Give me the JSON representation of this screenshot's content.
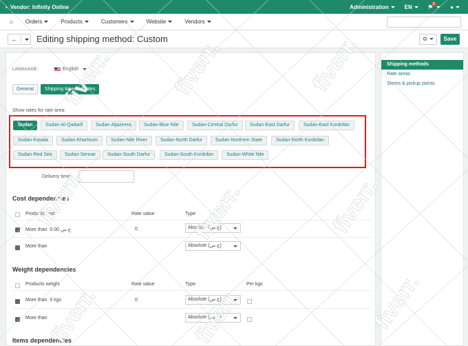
{
  "topbar": {
    "vendor": "Vendor: Infinity Online",
    "administration": "Administration",
    "lang": "EN",
    "notif_count": "2"
  },
  "nav": {
    "items": [
      "Orders",
      "Products",
      "Customers",
      "Website",
      "Vendors"
    ]
  },
  "toolbar": {
    "title": "Editing shipping method: Custom",
    "save_label": "Save"
  },
  "form": {
    "language_label": "LANGUAGE:",
    "language_value": "English",
    "tabs": [
      "General",
      "Shipping time and rates"
    ],
    "rates_label": "Show rates for rate area:",
    "areas": [
      "Sudan",
      "Sudan-Al-Qadarif",
      "Sudan-Aljazeera",
      "Sudan-Blue Nile",
      "Sudan-Central Darfur",
      "Sudan-East Darfur",
      "Sudan-East Kordofan",
      "Sudan-Kasala",
      "Sudan-Khartoum",
      "Sudan-Nile River",
      "Sudan-North Darfur",
      "Sudan-Northern State",
      "Sudan-North Kordofan",
      "Sudan-Red Sea",
      "Sudan-Sennar",
      "Sudan-South Darfur",
      "Sudan-South Kordofan",
      "Sudan-White Nile"
    ],
    "delivery_label": "Delivery time:"
  },
  "cost": {
    "title": "Cost dependencies",
    "headers": [
      "Products cost",
      "Rate value",
      "Type"
    ],
    "rows": [
      {
        "label": "More than",
        "amount": "0.00",
        "currency": "ج.س",
        "rate": "0",
        "type": "Absolute (ج.س)"
      },
      {
        "label": "More than",
        "amount": "",
        "currency": "",
        "rate": "",
        "type": "Absolute (ج.س)"
      }
    ]
  },
  "weight": {
    "title": "Weight dependencies",
    "headers": [
      "Products weight",
      "Rate value",
      "Type",
      "Per kgs"
    ],
    "rows": [
      {
        "label": "More than",
        "amount": "0",
        "unit": "kgs",
        "rate": "0",
        "type": "Absolute (ج.س)"
      },
      {
        "label": "More than",
        "amount": "",
        "unit": "",
        "rate": "",
        "type": "Absolute (ج.س)"
      }
    ]
  },
  "items": {
    "title": "Items dependencies"
  },
  "sidebar": {
    "items": [
      "Shipping methods",
      "Rate areas",
      "Stores & pickup points"
    ]
  },
  "watermark": "fiverr.",
  "colors": {
    "accent": "#1e8a6a",
    "highlight": "#e01b1b",
    "link": "#1e6f8a"
  }
}
